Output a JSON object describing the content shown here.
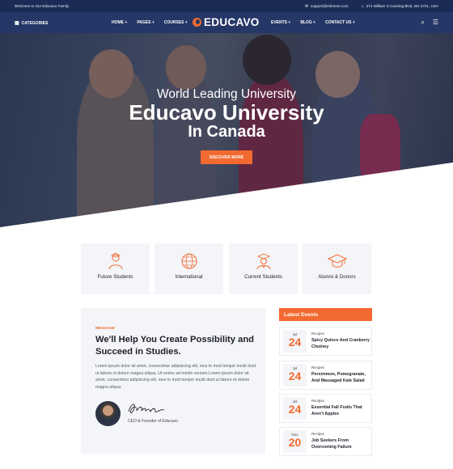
{
  "colors": {
    "accent": "#f26a30",
    "topbar": "#1b2b55",
    "nav": "#253766"
  },
  "topbar": {
    "welcome": "Welcome to Our Educavo Family",
    "email": "support@rstheme.com",
    "address": "374 William S Canning Blvd, MA 2721, USA",
    "email_icon": "mail-icon",
    "address_icon": "location-icon"
  },
  "nav": {
    "categories_label": "CATEGORIES",
    "left_links": [
      "HOME +",
      "PAGES +",
      "COURSES +"
    ],
    "logo_text": "EDUCAVO",
    "right_links": [
      "EVENTS +",
      "BLOG +",
      "CONTACT US +"
    ],
    "search_icon": "search-icon",
    "menu_icon": "hamburger-icon"
  },
  "hero": {
    "line1": "World Leading University",
    "line2": "Educavo University",
    "line3": "In Canada",
    "button": "DISCOVER MORE"
  },
  "features": [
    {
      "label": "Future Students",
      "icon": "student-icon"
    },
    {
      "label": "International",
      "icon": "globe-icon"
    },
    {
      "label": "Current Students",
      "icon": "graduate-icon"
    },
    {
      "label": "Alumni & Donors",
      "icon": "graduation-cap-icon"
    }
  ],
  "message": {
    "tag": "MESSAGE",
    "title": "We'll Help You Create Possibility and Succeed in Studies.",
    "body": "Lorem ipsum dolor sit amet, consectetur adipisicing elit, eius to mod tempor incidi dunt ut labore et dolore magna aliqua. Ut enims ad minim veniam.Lorem ipsum dolor sit amet, consectetur adipisicing elit, eius to mod tempor incidi dunt ut labore et dolore magna aliqua.",
    "role": "CEO & Founder of Educavo"
  },
  "events": {
    "heading": "Latest Events",
    "items": [
      {
        "month": "Jul",
        "day": "24",
        "category": "Recipes",
        "title": "Spicy Quince And Cranberry Chutney"
      },
      {
        "month": "Jul",
        "day": "24",
        "category": "Recipes",
        "title": "Persimmon, Pomegranate, And Massaged Kale Salad"
      },
      {
        "month": "Jul",
        "day": "24",
        "category": "Recipes",
        "title": "Essential Fall Fruits That Aren't Apples"
      },
      {
        "month": "Nov",
        "day": "20",
        "category": "Recipes",
        "title": "Job Seekers From Overcoming Failure"
      }
    ]
  }
}
